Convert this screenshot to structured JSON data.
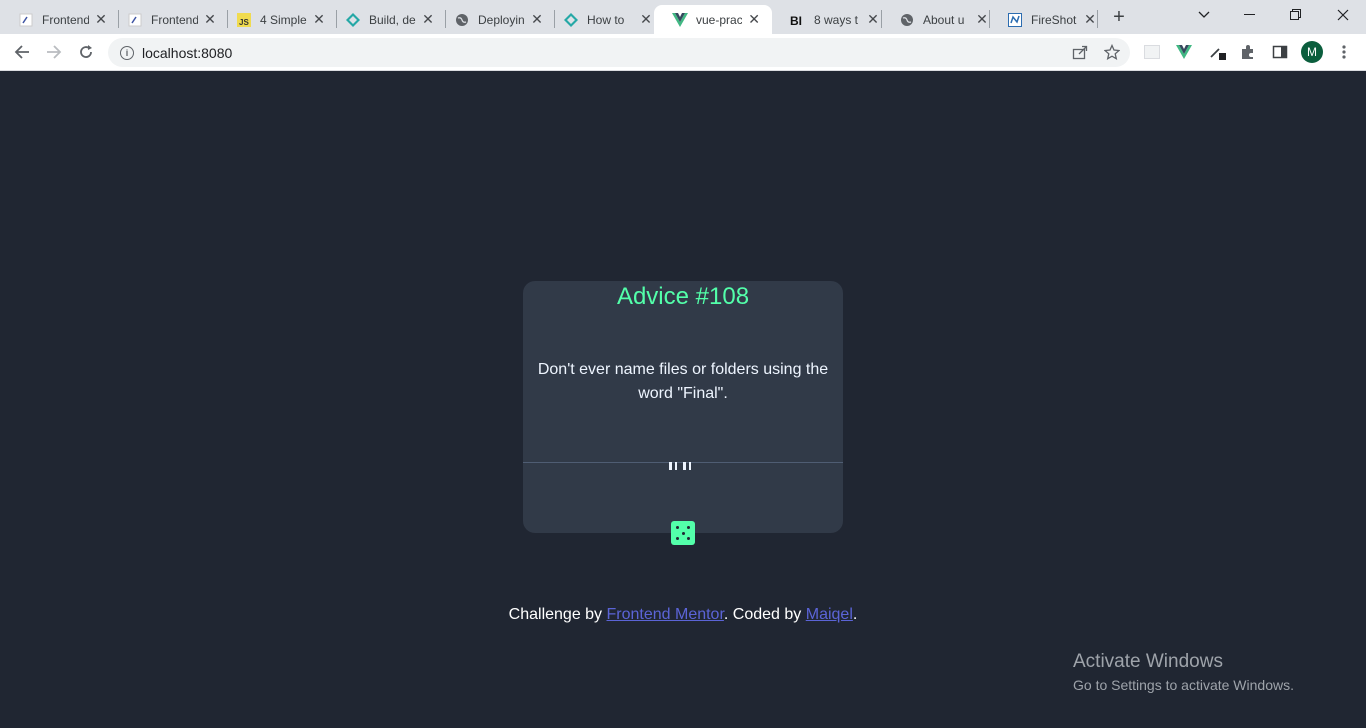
{
  "browser": {
    "tabs": [
      {
        "title": "Frontend",
        "icon": "fm-icon"
      },
      {
        "title": "Frontend",
        "icon": "fm-icon"
      },
      {
        "title": "4 Simple",
        "icon": "js-icon"
      },
      {
        "title": "Build, de",
        "icon": "netlify-icon"
      },
      {
        "title": "Deployin",
        "icon": "globe-icon"
      },
      {
        "title": "How to",
        "icon": "netlify-icon"
      },
      {
        "title": "vue-prac",
        "icon": "vue-icon",
        "active": true
      },
      {
        "title": "8 ways t",
        "icon": "bi-icon"
      },
      {
        "title": "About u",
        "icon": "globe-icon"
      },
      {
        "title": "FireShot",
        "icon": "fireshot-icon"
      }
    ],
    "url": "localhost:8080",
    "profile_initial": "M"
  },
  "card": {
    "title": "Advice #108",
    "advice": "Don't ever name files or folders using the word \"Final\"."
  },
  "footer": {
    "prefix": "Challenge by ",
    "link1": "Frontend Mentor",
    "middle": ". Coded by ",
    "link2": "Maiqel",
    "suffix": "."
  },
  "watermark": {
    "line1": "Activate Windows",
    "line2": "Go to Settings to activate Windows."
  },
  "colors": {
    "background": "#202632",
    "card": "#313a48",
    "accent": "#53ffaa",
    "link": "#5b64d6"
  }
}
